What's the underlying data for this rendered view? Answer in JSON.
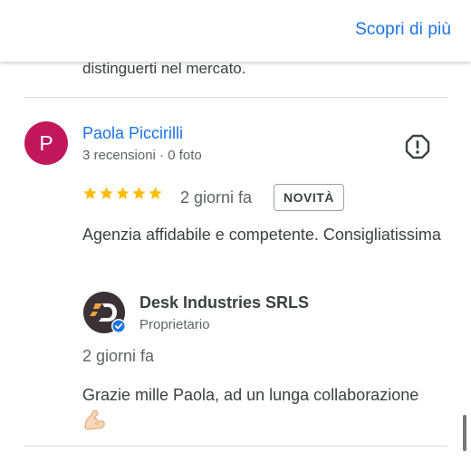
{
  "header": {
    "link_label": "Scopri di più"
  },
  "previous_review": {
    "text_tail": "distinguerti nel mercato."
  },
  "review": {
    "avatar_letter": "P",
    "author": "Paola Piccirilli",
    "meta": "3 recensioni · 0 foto",
    "rating": 5,
    "time": "2 giorni fa",
    "badge": "NOVITÀ",
    "text": "Agenzia affidabile e competente. Consigliatissima"
  },
  "owner_reply": {
    "name": "Desk Industries SRLS",
    "role": "Proprietario",
    "time": "2 giorni fa",
    "text": "Grazie mille Paola, ad un lunga collaborazione",
    "emoji_icon": "flexed-biceps-icon"
  },
  "colors": {
    "link": "#1a73e8",
    "avatar_bg": "#c2185b",
    "star": "#fbbc04",
    "verified": "#1a73e8"
  }
}
